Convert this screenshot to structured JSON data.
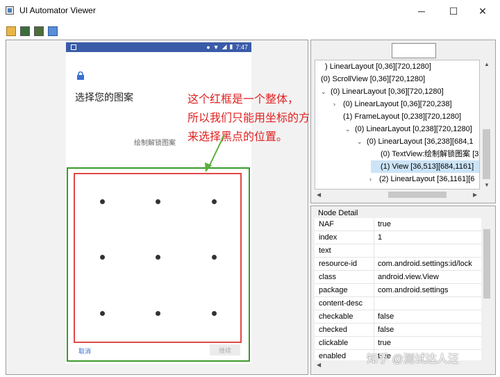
{
  "window": {
    "title": "UI Automator Viewer",
    "minimize": "─",
    "maximize": "☐",
    "close": "✕"
  },
  "phone": {
    "time": "7:47",
    "header": "选择您的图案",
    "hint": "绘制解锁图案",
    "cancel": "取消",
    "continue": "继续"
  },
  "annotation": {
    "lines": [
      "这个红框是一个整体，",
      "所以我们只能用坐标的方式",
      "来选择黑点的位置。"
    ],
    "color": "#e02020"
  },
  "tree": {
    "items": [
      {
        "arrow": "",
        "label": ") LinearLayout [0,36][720,1280]"
      },
      {
        "arrow": "",
        "label": "(0) ScrollView [0,36][720,1280]"
      },
      {
        "arrow": "⌄",
        "label": "(0) LinearLayout [0,36][720,1280]"
      },
      {
        "arrow": "›",
        "label": "(0) LinearLayout [0,36][720,238]"
      },
      {
        "arrow": "",
        "label": "(1) FrameLayout [0,238][720,1280]"
      },
      {
        "arrow": "⌄",
        "label": "(0) LinearLayout [0,238][720,1280]"
      },
      {
        "arrow": "⌄",
        "label": "(0) LinearLayout [36,238][684,1"
      },
      {
        "arrow": "",
        "label": "(0) TextView:绘制解锁图案 [3"
      },
      {
        "arrow": "",
        "label": "(1) View [36,513][684,1161]"
      },
      {
        "arrow": "›",
        "label": "(2) LinearLayout [36,1161][6"
      }
    ]
  },
  "node_detail": {
    "title": "Node Detail",
    "rows": [
      {
        "key": "NAF",
        "value": "true"
      },
      {
        "key": "index",
        "value": "1"
      },
      {
        "key": "text",
        "value": ""
      },
      {
        "key": "resource-id",
        "value": "com.android.settings:id/lock"
      },
      {
        "key": "class",
        "value": "android.view.View"
      },
      {
        "key": "package",
        "value": "com.android.settings"
      },
      {
        "key": "content-desc",
        "value": ""
      },
      {
        "key": "checkable",
        "value": "false"
      },
      {
        "key": "checked",
        "value": "false"
      },
      {
        "key": "clickable",
        "value": "true"
      },
      {
        "key": "enabled",
        "value": "true"
      }
    ]
  },
  "watermark": "知乎 @测试达人汪",
  "colors": {
    "status_bar": "#3a5ba8",
    "green_frame": "#3b9a2c",
    "red_frame": "#e04848",
    "selection": "#cce4f7"
  }
}
